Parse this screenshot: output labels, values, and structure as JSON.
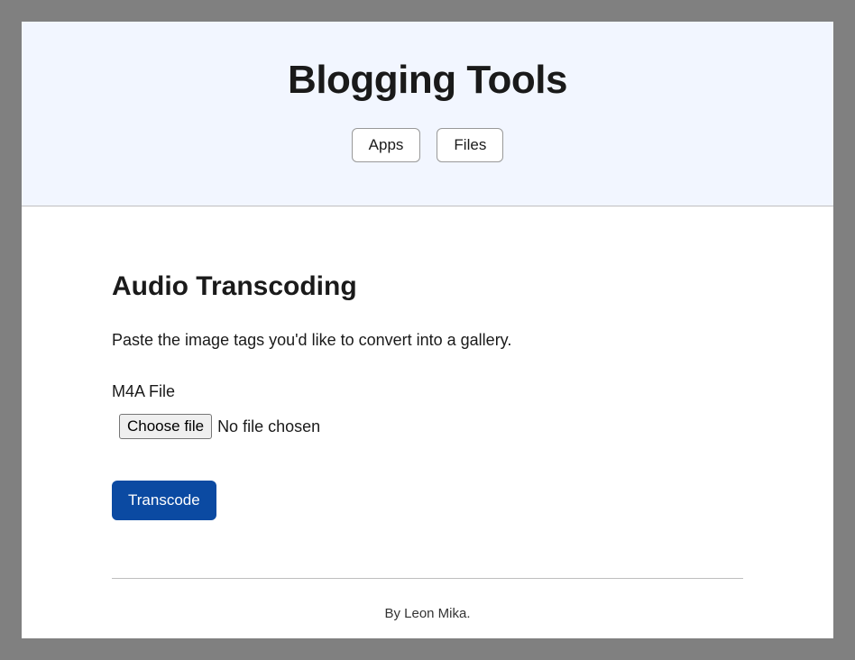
{
  "header": {
    "title": "Blogging Tools",
    "nav": [
      {
        "label": "Apps"
      },
      {
        "label": "Files"
      }
    ]
  },
  "main": {
    "heading": "Audio Transcoding",
    "description": "Paste the image tags you'd like to convert into a gallery.",
    "file_field": {
      "label": "M4A File",
      "button_label": "Choose file",
      "status_text": "No file chosen"
    },
    "submit_label": "Transcode"
  },
  "footer": {
    "text": "By Leon Mika."
  }
}
